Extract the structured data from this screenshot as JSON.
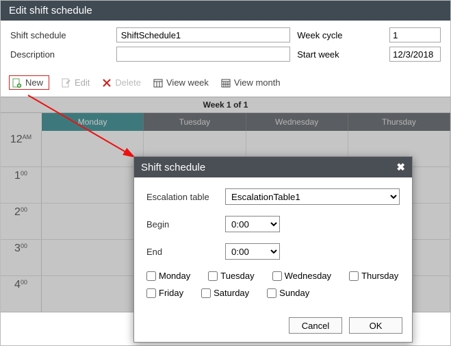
{
  "titlebar": {
    "title": "Edit shift schedule"
  },
  "form": {
    "shift_label": "Shift schedule",
    "shift_value": "ShiftSchedule1",
    "desc_label": "Description",
    "desc_value": "",
    "week_cycle_label": "Week cycle",
    "week_cycle_value": "1",
    "start_week_label": "Start week",
    "start_week_value": "12/3/2018"
  },
  "toolbar": {
    "new_label": "New",
    "edit_label": "Edit",
    "delete_label": "Delete",
    "view_week_label": "View week",
    "view_month_label": "View month"
  },
  "calendar": {
    "week_header": "Week 1 of 1",
    "days": [
      "Monday",
      "Tuesday",
      "Wednesday",
      "Thursday"
    ],
    "selected_day": "Monday",
    "time_rows": [
      {
        "h": "12",
        "m": "AM"
      },
      {
        "h": "1",
        "m": "00"
      },
      {
        "h": "2",
        "m": "00"
      },
      {
        "h": "3",
        "m": "00"
      },
      {
        "h": "4",
        "m": "00"
      }
    ]
  },
  "modal": {
    "title": "Shift schedule",
    "escalation_label": "Escalation table",
    "escalation_value": "EscalationTable1",
    "begin_label": "Begin",
    "begin_value": "0:00",
    "end_label": "End",
    "end_value": "0:00",
    "days_row1": [
      "Monday",
      "Tuesday",
      "Wednesday",
      "Thursday"
    ],
    "days_row2": [
      "Friday",
      "Saturday",
      "Sunday"
    ],
    "cancel_label": "Cancel",
    "ok_label": "OK"
  }
}
